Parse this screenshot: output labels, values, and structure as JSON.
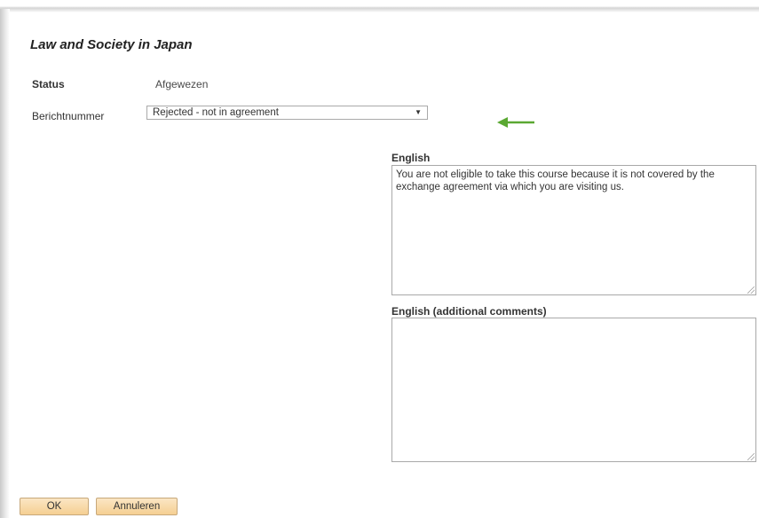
{
  "dialog": {
    "title": "Law and Society in Japan"
  },
  "form": {
    "status_label": "Status",
    "status_value": "Afgewezen",
    "berichtnummer_label": "Berichtnummer",
    "berichtnummer_selected": "Rejected - not in agreement",
    "english_label": "English",
    "english_text": "You are not eligible to take this course because it is not covered by the exchange agreement via which you are visiting us.",
    "additional_label": "English (additional comments)",
    "additional_text": ""
  },
  "buttons": {
    "ok_label": "OK",
    "cancel_label": "Annuleren"
  },
  "colors": {
    "annotation_arrow": "#5aa832",
    "button_fill": "#f5cf92"
  },
  "icons": {
    "select_arrow": "triangle-down",
    "annotation": "left-arrow"
  }
}
